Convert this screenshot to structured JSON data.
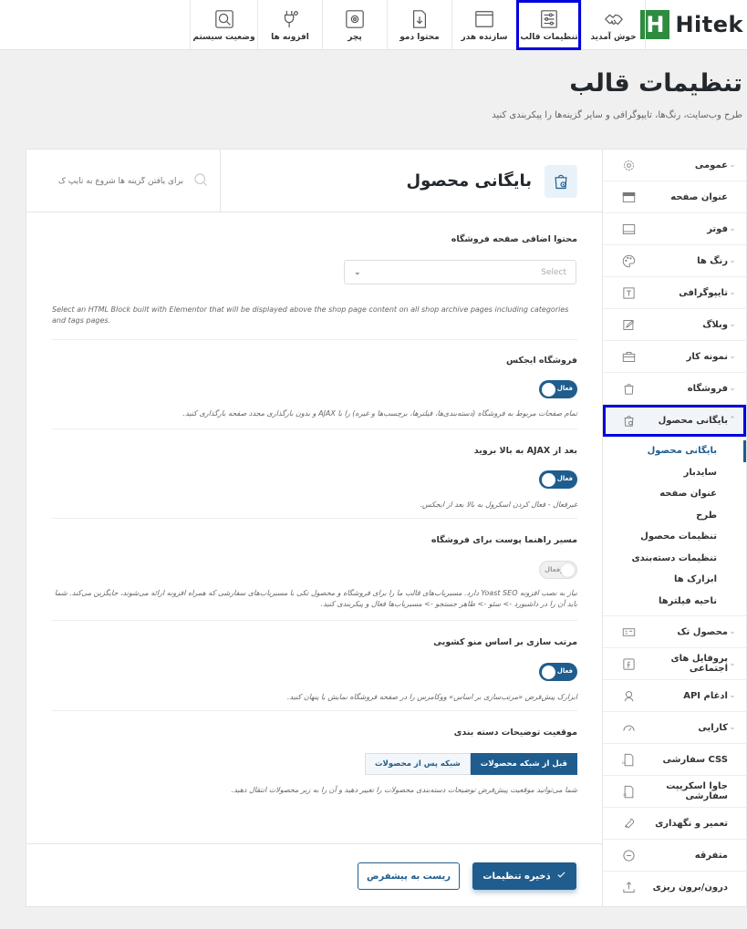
{
  "brand": {
    "logo_letter": "H",
    "logo_text": "Hitek",
    "accent": "#1f5d8e",
    "logo_color": "#2e8b3f",
    "highlight": "#0000dd"
  },
  "topnav": [
    {
      "label": "خوش آمدید",
      "icon": "handshake-icon"
    },
    {
      "label": "تنظیمات قالب",
      "icon": "sliders-icon",
      "active": true
    },
    {
      "label": "سازنده هدر",
      "icon": "window-icon"
    },
    {
      "label": "محتوا دمو",
      "icon": "download-doc-icon"
    },
    {
      "label": "پچر",
      "icon": "gear-box-icon"
    },
    {
      "label": "افزونه ها",
      "icon": "plug-icon"
    },
    {
      "label": "وضعیت سیستم",
      "icon": "search-gear-icon"
    }
  ],
  "page": {
    "title": "تنظیمات قالب",
    "subtitle": "طرح وب‌سایت، رنگ‌ها، تایپوگرافی و سایر گزینه‌ها را پیکربندی کنید"
  },
  "sidebar": {
    "items": [
      {
        "label": "عمومی",
        "icon": "gear-icon",
        "chevron": true
      },
      {
        "label": "عنوان صفحه",
        "icon": "title-bar-icon",
        "chevron": false
      },
      {
        "label": "فوتر",
        "icon": "footer-icon",
        "chevron": true
      },
      {
        "label": "رنگ ها",
        "icon": "palette-icon",
        "chevron": true
      },
      {
        "label": "تایپوگرافی",
        "icon": "typography-icon",
        "chevron": true
      },
      {
        "label": "وبلاگ",
        "icon": "edit-icon",
        "chevron": true
      },
      {
        "label": "نمونه کار",
        "icon": "briefcase-icon",
        "chevron": true
      },
      {
        "label": "فروشگاه",
        "icon": "bag-icon",
        "chevron": true
      },
      {
        "label": "بایگانی محصول",
        "icon": "bag-clock-icon",
        "chevron": true,
        "active": true
      }
    ],
    "subitems": [
      "بایگانی محصول",
      "سایدبار",
      "عنوان صفحه",
      "طرح",
      "تنظیمات محصول",
      "تنظیمات دسته‌بندی",
      "ابزارک ها",
      "ناحیه فیلترها"
    ],
    "items_after": [
      {
        "label": "محصول تک",
        "icon": "product-icon",
        "chevron": true
      },
      {
        "label": "پروفایل های اجتماعی",
        "icon": "facebook-icon",
        "chevron": true
      },
      {
        "label": "ادغام API",
        "icon": "api-icon",
        "chevron": true
      },
      {
        "label": "کارایی",
        "icon": "speed-icon",
        "chevron": true
      },
      {
        "label": "CSS سفارشی",
        "icon": "css-icon",
        "chevron": false
      },
      {
        "label": "جاوا اسکریپت سفارشی",
        "icon": "js-icon",
        "chevron": false
      },
      {
        "label": "تعمیر و نگهداری",
        "icon": "wrench-icon",
        "chevron": false
      },
      {
        "label": "متفرقه",
        "icon": "minus-circle-icon",
        "chevron": false
      },
      {
        "label": "درون/برون ریزی",
        "icon": "upload-icon",
        "chevron": false
      }
    ]
  },
  "content": {
    "title": "بایگانی محصول",
    "search_placeholder": "برای یافتن گزینه ها شروع به تایپ ک",
    "s1": {
      "title": "محتوا اضافی صفحه فروشگاه",
      "select_placeholder": "Select",
      "desc": "Select an HTML Block built with Elementor that will be displayed above the shop page content on all shop archive pages including categories and tags pages."
    },
    "s2": {
      "title": "فروشگاه ایجکس",
      "toggle": "فعال",
      "desc": "تمام صفحات مربوط به فروشگاه (دسته‌بندی‌ها، فیلترها، برچسب‌ها و غیره) را با AJAX و بدون بارگذاری مجدد صفحه بارگذاری کنید."
    },
    "s3": {
      "title": "بعد از AJAX به بالا بروید",
      "toggle": "فعال",
      "desc": "غیرفعال - فعال کردن اسکرول به بالا بعد از ایجکس."
    },
    "s4": {
      "title": "مسیر راهنما پوست برای فروشگاه",
      "toggle": "غیرفعال",
      "desc": "نیاز به نصب افزونه Yoast SEO دارد. مسیریاب‌های قالب ما را برای فروشگاه و محصول تکی با مسیریاب‌های سفارشی که همراه افزونه ارائه می‌شوند، جایگزین می‌کند. شما باید آن را در داشبورد -> سئو -> ظاهر جستجو -> مسیریاب‌ها فعال و پیکربندی کنید."
    },
    "s5": {
      "title": "مرتب سازی بر اساس منو کشویی",
      "toggle": "فعال",
      "desc": "ابزارک پیش‌فرض «مرتب‌سازی بر اساس» ووکامرس را در صفحه فروشگاه نمایش یا پنهان کنید."
    },
    "s6": {
      "title": "موقعیت توضیحات دسته بندی",
      "options": [
        "قبل از شبکه محصولات",
        "شبکه پس از محصولات"
      ],
      "desc": "شما می‌توانید موقعیت پیش‌فرض توضیحات دسته‌بندی محصولات را تغییر دهید و آن را به زیر محصولات انتقال دهید."
    }
  },
  "footer": {
    "save": "ذخیره تنظیمات",
    "reset": "ریست به پیشفرض"
  }
}
